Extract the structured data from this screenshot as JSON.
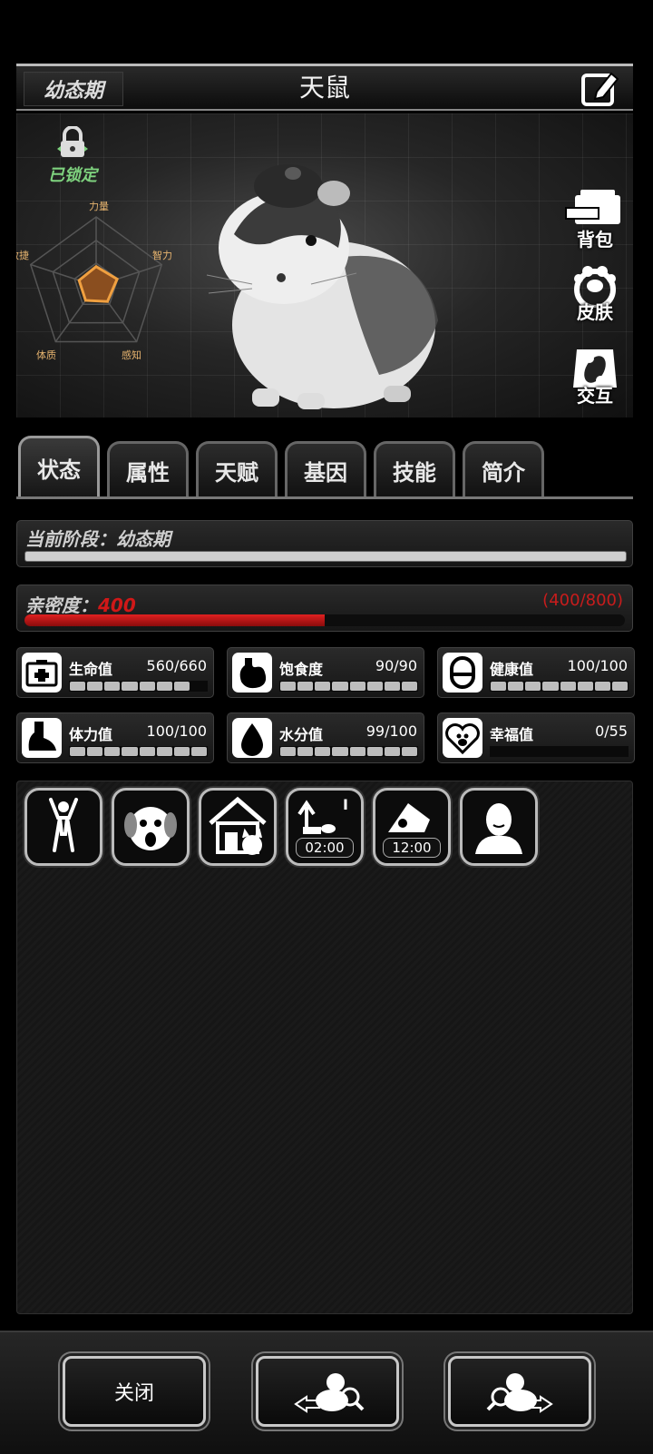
{
  "header": {
    "stage": "幼态期",
    "name": "天鼠"
  },
  "portrait": {
    "lock_label": "已锁定",
    "radar": {
      "labels": [
        "力量",
        "智力",
        "感知",
        "体质",
        "敏捷"
      ],
      "values": [
        0.28,
        0.32,
        0.28,
        0.26,
        0.26
      ]
    },
    "side_buttons": {
      "backpack": "背包",
      "skin": "皮肤",
      "interact": "交互"
    }
  },
  "tabs": [
    "状态",
    "属性",
    "天赋",
    "基因",
    "技能",
    "简介"
  ],
  "stage_bar": {
    "label": "当前阶段：幼态期",
    "progress": 1.0
  },
  "intimacy": {
    "label": "亲密度：",
    "value": "400",
    "range": "(400/800)",
    "progress": 0.5
  },
  "stats": [
    {
      "name": "生命值",
      "value": "560/660",
      "level": 0.85,
      "icon": "medkit-icon"
    },
    {
      "name": "饱食度",
      "value": "90/90",
      "level": 1.0,
      "icon": "stomach-icon"
    },
    {
      "name": "健康值",
      "value": "100/100",
      "level": 1.0,
      "icon": "pill-icon"
    },
    {
      "name": "体力值",
      "value": "100/100",
      "level": 1.0,
      "icon": "foot-icon"
    },
    {
      "name": "水分值",
      "value": "99/100",
      "level": 1.0,
      "icon": "water-drop-icon"
    },
    {
      "name": "幸福值",
      "value": "0/55",
      "level": 0.0,
      "icon": "heart-paw-icon"
    }
  ],
  "actions": {
    "sleep_timer": "02:00",
    "feed_timer": "12:00",
    "exercise_mark": "I"
  },
  "bottom": {
    "close": "关闭"
  }
}
